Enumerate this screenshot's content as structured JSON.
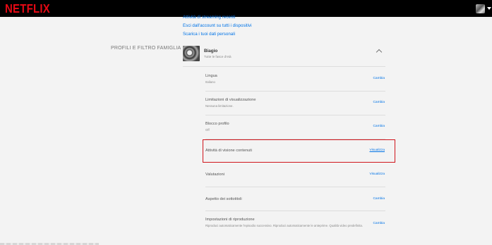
{
  "header": {
    "logo": "NETFLIX"
  },
  "account_links": [
    "Attività di streaming recenti",
    "Esci dall'account su tutti i dispositivi",
    "Scarica i tuoi dati personali"
  ],
  "section": {
    "title": "PROFILI E FILTRO FAMIGLIA"
  },
  "profile": {
    "name": "Biagio",
    "maturity": "Tutte le fasce d'età"
  },
  "settings": [
    {
      "title": "Lingua",
      "value": "Italiano",
      "action": "Cambia"
    },
    {
      "title": "Limitazioni di visualizzazione",
      "value": "Nessuna limitazione.",
      "action": "Cambia"
    },
    {
      "title": "Blocco profilo",
      "value": "Off",
      "action": "Cambia"
    },
    {
      "title": "Attività di visione contenuti",
      "value": "",
      "action": "Visualizza"
    },
    {
      "title": "Valutazioni",
      "value": "",
      "action": "Visualizza"
    },
    {
      "title": "Aspetto dei sottotitoli",
      "value": "",
      "action": "Cambia"
    },
    {
      "title": "Impostazioni di riproduzione",
      "value": "Riproduci automaticamente l'episodio successivo. Riproduci automaticamente le anteprime. Qualità video predefinita.",
      "action": "Cambia"
    }
  ],
  "colors": {
    "brand": "#e50914",
    "link": "#0073e6",
    "highlight_border": "#d0141b"
  },
  "icons": {
    "profile_menu_caret": "caret-down-icon",
    "collapse": "chevron-up-icon"
  }
}
